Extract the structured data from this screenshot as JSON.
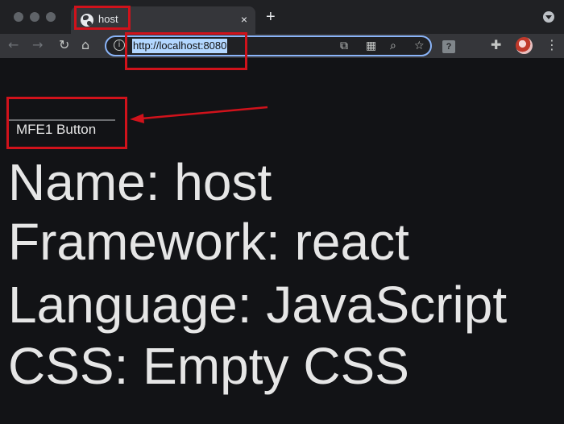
{
  "browser": {
    "tab": {
      "title": "host",
      "close_symbol": "×"
    },
    "new_tab_symbol": "+",
    "toolbar": {
      "back_symbol": "←",
      "forward_symbol": "→",
      "reload_symbol": "↻",
      "home_symbol": "⌂",
      "info_symbol": "i",
      "url": "http://localhost:8080",
      "cast_symbol": "⧉",
      "qr_symbol": "▦",
      "zoom_symbol": "⌕",
      "bookmark_symbol": "☆",
      "extension_box_symbol": "?",
      "puzzle_symbol": "✚",
      "menu_symbol": "⋮"
    }
  },
  "page": {
    "mfe1_button_label": "MFE1 Button",
    "lines": {
      "name": "Name: host",
      "framework": "Framework: react",
      "language": "Language: JavaScript",
      "css": "CSS: Empty CSS"
    }
  },
  "annotation": {
    "color": "#d0121b"
  }
}
